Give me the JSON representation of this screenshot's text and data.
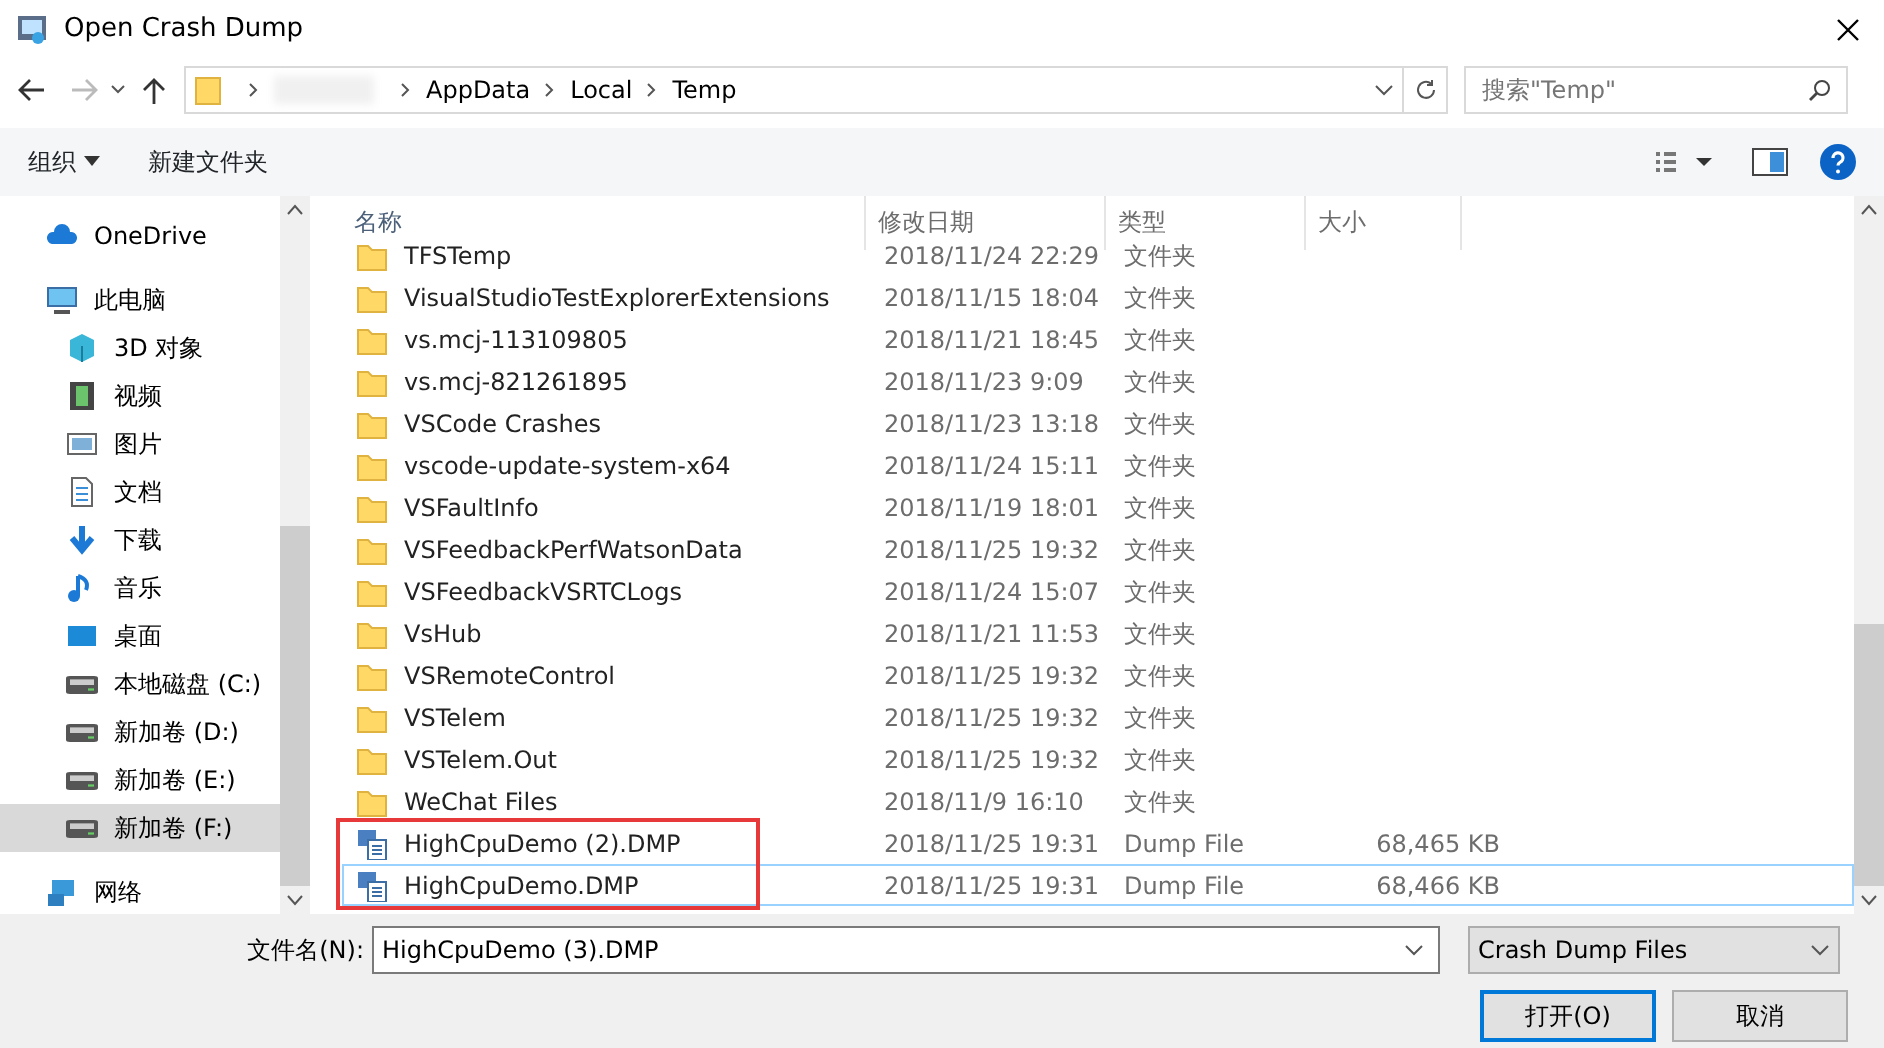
{
  "window": {
    "title": "Open Crash Dump"
  },
  "address_bar": {
    "segments": [
      "AppData",
      "Local",
      "Temp"
    ]
  },
  "search": {
    "placeholder": "搜索\"Temp\""
  },
  "toolbar": {
    "organize": "组织",
    "new_folder": "新建文件夹"
  },
  "sidebar": {
    "items": [
      {
        "label": "OneDrive",
        "kind": "cloud",
        "selected": false
      },
      {
        "label": "此电脑",
        "kind": "pc",
        "selected": false,
        "children": [
          {
            "label": "3D 对象",
            "kind": "cube",
            "selected": false
          },
          {
            "label": "视频",
            "kind": "film",
            "selected": false
          },
          {
            "label": "图片",
            "kind": "picture",
            "selected": false
          },
          {
            "label": "文档",
            "kind": "doc",
            "selected": false
          },
          {
            "label": "下载",
            "kind": "download",
            "selected": false
          },
          {
            "label": "音乐",
            "kind": "music",
            "selected": false
          },
          {
            "label": "桌面",
            "kind": "desktop",
            "selected": false
          },
          {
            "label": "本地磁盘 (C:)",
            "kind": "drive",
            "selected": false
          },
          {
            "label": "新加卷 (D:)",
            "kind": "drive",
            "selected": false
          },
          {
            "label": "新加卷 (E:)",
            "kind": "drive",
            "selected": false
          },
          {
            "label": "新加卷 (F:)",
            "kind": "drive",
            "selected": true
          }
        ]
      },
      {
        "label": "网络",
        "kind": "network",
        "selected": false
      }
    ]
  },
  "table": {
    "columns": [
      "名称",
      "修改日期",
      "类型",
      "大小"
    ],
    "rows": [
      {
        "kind": "folder",
        "name": "TFSTemp",
        "date": "2018/11/24 22:29",
        "type": "文件夹",
        "selected": false,
        "outlined": false
      },
      {
        "kind": "folder",
        "name": "VisualStudioTestExplorerExtensions",
        "date": "2018/11/15 18:04",
        "type": "文件夹",
        "selected": false,
        "outlined": false
      },
      {
        "kind": "folder",
        "name": "vs.mcj-113109805",
        "date": "2018/11/21 18:45",
        "type": "文件夹",
        "selected": false,
        "outlined": false
      },
      {
        "kind": "folder",
        "name": "vs.mcj-821261895",
        "date": "2018/11/23 9:09",
        "type": "文件夹",
        "selected": false,
        "outlined": false
      },
      {
        "kind": "folder",
        "name": "VSCode Crashes",
        "date": "2018/11/23 13:18",
        "type": "文件夹",
        "selected": false,
        "outlined": false
      },
      {
        "kind": "folder",
        "name": "vscode-update-system-x64",
        "date": "2018/11/24 15:11",
        "type": "文件夹",
        "selected": false,
        "outlined": false
      },
      {
        "kind": "folder",
        "name": "VSFaultInfo",
        "date": "2018/11/19 18:01",
        "type": "文件夹",
        "selected": false,
        "outlined": false
      },
      {
        "kind": "folder",
        "name": "VSFeedbackPerfWatsonData",
        "date": "2018/11/25 19:32",
        "type": "文件夹",
        "selected": false,
        "outlined": false
      },
      {
        "kind": "folder",
        "name": "VSFeedbackVSRTCLogs",
        "date": "2018/11/24 15:07",
        "type": "文件夹",
        "selected": false,
        "outlined": false
      },
      {
        "kind": "folder",
        "name": "VsHub",
        "date": "2018/11/21 11:53",
        "type": "文件夹",
        "selected": false,
        "outlined": false
      },
      {
        "kind": "folder",
        "name": "VSRemoteControl",
        "date": "2018/11/25 19:32",
        "type": "文件夹",
        "selected": false,
        "outlined": false
      },
      {
        "kind": "folder",
        "name": "VSTelem",
        "date": "2018/11/25 19:32",
        "type": "文件夹",
        "selected": false,
        "outlined": false
      },
      {
        "kind": "folder",
        "name": "VSTelem.Out",
        "date": "2018/11/25 19:32",
        "type": "文件夹",
        "selected": false,
        "outlined": false
      },
      {
        "kind": "folder",
        "name": "WeChat Files",
        "date": "2018/11/9 16:10",
        "type": "文件夹",
        "selected": false,
        "outlined": false
      },
      {
        "kind": "dump",
        "name": "HighCpuDemo (2).DMP",
        "date": "2018/11/25 19:31",
        "type": "Dump File",
        "size": "68,465 KB",
        "selected": false,
        "outlined": true
      },
      {
        "kind": "dump",
        "name": "HighCpuDemo.DMP",
        "date": "2018/11/25 19:31",
        "type": "Dump File",
        "size": "68,466 KB",
        "selected": true,
        "outlined": true
      }
    ]
  },
  "footer": {
    "filename_label": "文件名(N):",
    "filename": "HighCpuDemo (3).DMP",
    "filter": "Crash Dump Files",
    "open_button": "打开(O)",
    "cancel_button": "取消"
  }
}
